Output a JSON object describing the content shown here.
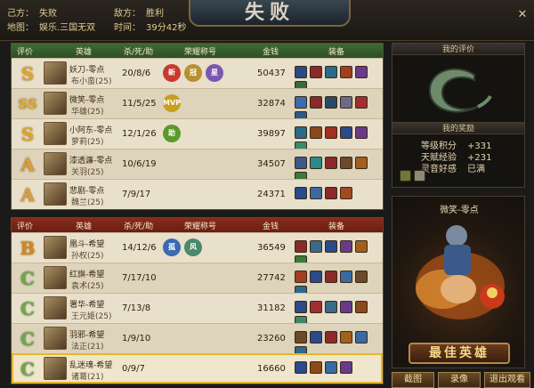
{
  "header": {
    "own_side_label": "己方：",
    "own_side_value": "失败",
    "enemy_side_label": "敌方：",
    "enemy_side_value": "胜利",
    "map_label": "地图：",
    "map_value": "娱乐.三国无双",
    "time_label": "时间：",
    "time_value": "39分42秒",
    "result_title": "失败"
  },
  "columns": {
    "grade": "评价",
    "hero": "英雄",
    "kda": "杀/死/助",
    "honor": "荣耀称号",
    "gold": "金钱",
    "equip": "装备"
  },
  "colors": {
    "team_green": "#3f6b33",
    "team_red": "#8a2a1c",
    "highlight": "#e6b62c",
    "panel_bg": "#e9e0cc"
  },
  "team_a": [
    {
      "grade": "S",
      "name": "妖刀-零点",
      "hero": "布小蛮(25)",
      "kda": "20/8/6",
      "gold": "50437",
      "honors": [
        {
          "icon": "new-honor-icon",
          "text": "新",
          "color": "#c83a2a"
        },
        {
          "icon": "crown-honor-icon",
          "text": "冠",
          "color": "#b89030"
        },
        {
          "icon": "star-honor-icon",
          "text": "星",
          "color": "#7a58b0"
        }
      ],
      "equips": [
        "#2a4a8a",
        "#8a2a2a",
        "#2a6a8a",
        "#a04020",
        "#6a3a8a",
        "#3a6a3a"
      ]
    },
    {
      "grade": "SS",
      "name": "微笑-零点",
      "hero": "华雄(25)",
      "kda": "11/5/25",
      "gold": "32874",
      "honors": [
        {
          "icon": "mvp-icon",
          "text": "MVP",
          "color": "#c8a020"
        }
      ],
      "equips": [
        "#3a6ab0",
        "#8a2a2a",
        "#2a4a6a",
        "#6a6a8a",
        "#a03030",
        "#2a5a8a"
      ]
    },
    {
      "grade": "S",
      "name": "小阿东-零点",
      "hero": "萝莉(25)",
      "kda": "12/1/26",
      "gold": "39897",
      "honors": [
        {
          "icon": "assist-honor-icon",
          "text": "助",
          "color": "#5a9a2a"
        }
      ],
      "equips": [
        "#2a6a8a",
        "#8a4a1a",
        "#a03020",
        "#2a4a8a",
        "#6a3a8a",
        "#3a8a6a"
      ]
    },
    {
      "grade": "A",
      "name": "漆透濂-零点",
      "hero": "关羽(25)",
      "kda": "10/6/19",
      "gold": "34507",
      "honors": [],
      "equips": [
        "#3a5a8a",
        "#2a8a8a",
        "#8a2a2a",
        "#6a4a2a",
        "#a06020",
        "#3a7a3a"
      ]
    },
    {
      "grade": "A",
      "name": "悲剧-零点",
      "hero": "魏兰(25)",
      "kda": "7/9/17",
      "gold": "24371",
      "honors": [],
      "equips": [
        "#2a4a8a",
        "#3a6aa0",
        "#8a2a2a",
        "#a04a20"
      ]
    }
  ],
  "team_b": [
    {
      "grade": "B",
      "name": "凰斗-希望",
      "hero": "孙权(25)",
      "kda": "14/12/6",
      "gold": "36549",
      "honors": [
        {
          "icon": "lone-honor-icon",
          "text": "孤",
          "color": "#3a6ab0"
        },
        {
          "icon": "wind-honor-icon",
          "text": "风",
          "color": "#4a8a6a"
        }
      ],
      "equips": [
        "#8a2a2a",
        "#3a6a8a",
        "#2a4a8a",
        "#6a3a8a",
        "#a06020",
        "#3a7a3a"
      ]
    },
    {
      "grade": "C",
      "name": "红旗-希望",
      "hero": "袁术(25)",
      "kda": "7/17/10",
      "gold": "27742",
      "honors": [],
      "equips": [
        "#a04020",
        "#2a4a8a",
        "#8a2a2a",
        "#3a6aa0",
        "#6a4a2a",
        "#2a6a8a"
      ]
    },
    {
      "grade": "C",
      "name": "署华-希望",
      "hero": "王元姬(25)",
      "kda": "7/13/8",
      "gold": "31182",
      "honors": [],
      "equips": [
        "#2a4a8a",
        "#a03030",
        "#3a6a8a",
        "#6a3a8a",
        "#8a4a1a",
        "#3a8a6a"
      ]
    },
    {
      "grade": "C",
      "name": "羽邪-希望",
      "hero": "法正(21)",
      "kda": "1/9/10",
      "gold": "23260",
      "honors": [],
      "equips": [
        "#6a4a2a",
        "#2a4a8a",
        "#8a2a2a",
        "#a06020",
        "#3a6aa0",
        "#2a6a8a"
      ]
    },
    {
      "grade": "C",
      "name": "乱迷魂-希望",
      "hero": "诸葛(21)",
      "kda": "0/9/7",
      "gold": "16660",
      "honors": [],
      "equips": [
        "#2a4a8a",
        "#8a4a1a",
        "#3a6aa0",
        "#6a3a8a"
      ]
    }
  ],
  "right_panel": {
    "eval_title": "我的评价",
    "reward_title": "我的奖励",
    "rewards": [
      {
        "label": "等级积分",
        "value": "+331"
      },
      {
        "label": "天赋经验",
        "value": "+231"
      },
      {
        "label": "灵音好感",
        "value": "已满"
      }
    ],
    "reward_item_colors": [
      "#6a7a3a",
      "#8a8a7a"
    ],
    "best_player_name": "微笑-零点",
    "best_title": "最佳英雄"
  },
  "buttons": {
    "screenshot": "截图",
    "replay": "录像",
    "exit_watch": "退出观看"
  }
}
